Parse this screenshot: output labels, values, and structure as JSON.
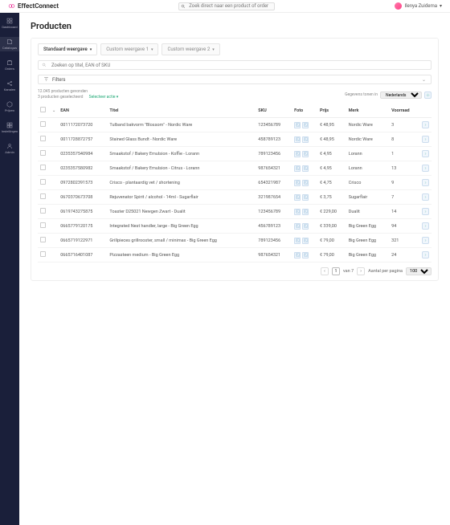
{
  "app": {
    "name": "EffectConnect",
    "search_placeholder": "Zoek direct naar een product of order"
  },
  "user": {
    "name": "Ilenya Zuidema"
  },
  "nav": [
    {
      "key": "dashboard",
      "label": "Dashboard"
    },
    {
      "key": "catalogus",
      "label": "Catalogus"
    },
    {
      "key": "orders",
      "label": "Orders"
    },
    {
      "key": "kanalen",
      "label": "Kanalen"
    },
    {
      "key": "prijzen",
      "label": "Prijzen"
    },
    {
      "key": "instellingen",
      "label": "Instellingen"
    },
    {
      "key": "admin",
      "label": "Admin"
    }
  ],
  "page": {
    "title": "Producten"
  },
  "tabs": [
    {
      "label": "Standaard weergave",
      "active": true
    },
    {
      "label": "Custom weergave 1"
    },
    {
      "label": "Custom weergave 2"
    }
  ],
  "card_search_placeholder": "Zoeken op titel, EAN of SKU",
  "filters_label": "Filters",
  "meta": {
    "line1": "12.045 producten gevonden",
    "line2": "3 producten geselecteerd",
    "select_action": "Selecteer actie",
    "lang_label": "Gegevens tonen in",
    "lang_value": "Nederlands"
  },
  "columns": [
    "",
    "",
    "EAN",
    "Titel",
    "SKU",
    "Foto",
    "Prijs",
    "Merk",
    "Voorraad",
    ""
  ],
  "rows": [
    {
      "ean": "0011172073720",
      "titel": "Tulband bakvorm \"Blossom\" - Nordic Ware",
      "sku": "123456789",
      "prijs": "€ 48,95",
      "merk": "Nordic Ware",
      "voorraad": "3"
    },
    {
      "ean": "0011728872757",
      "titel": "Stained Glass Bundt - Nordic Ware",
      "sku": "458789123",
      "prijs": "€ 48,95",
      "merk": "Nordic Ware",
      "voorraad": "8"
    },
    {
      "ean": "0235357540984",
      "titel": "Smaakstof / Bakery Emulsion - Koffie - Lorann",
      "sku": "789123456",
      "prijs": "€ 4,95",
      "merk": "Lorann",
      "voorraad": "1"
    },
    {
      "ean": "0235357580982",
      "titel": "Smaakstof / Bakery Emulsion - Citrus - Lorann",
      "sku": "987654321",
      "prijs": "€ 4,95",
      "merk": "Lorann",
      "voorraad": "13"
    },
    {
      "ean": "0972802391573",
      "titel": "Crisco - plantaardig vet / shortening",
      "sku": "654321987",
      "prijs": "€ 4,75",
      "merk": "Crisco",
      "voorraad": "9"
    },
    {
      "ean": "0670370673708",
      "titel": "Rejuvenator Spirit / alcohol - 14ml - Sugarflair",
      "sku": "321987654",
      "prijs": "€ 3,75",
      "merk": "Sugarflair",
      "voorraad": "7"
    },
    {
      "ean": "0619743275875",
      "titel": "Toaster D25021 Newgen Zwart - Dualit",
      "sku": "123456789",
      "prijs": "€ 229,00",
      "merk": "Dualit",
      "voorraad": "14"
    },
    {
      "ean": "0665779120175",
      "titel": "Integrated Nest handler, large - Big Green Egg",
      "sku": "456789123",
      "prijs": "€ 339,00",
      "merk": "Big Green Egg",
      "voorraad": "94"
    },
    {
      "ean": "0665719122971",
      "titel": "Grillpieces grillrooster, small / minimax - Big Green Egg",
      "sku": "789123456",
      "prijs": "€ 79,00",
      "merk": "Big Green Egg",
      "voorraad": "321"
    },
    {
      "ean": "0665716401087",
      "titel": "Pizzasteen medium - Big Green Egg",
      "sku": "987654321",
      "prijs": "€ 79,00",
      "merk": "Big Green Egg",
      "voorraad": "24"
    }
  ],
  "pager": {
    "page": "1",
    "of_label": "van 7",
    "per_page_label": "Aantal per pagina",
    "per_page": "100"
  }
}
